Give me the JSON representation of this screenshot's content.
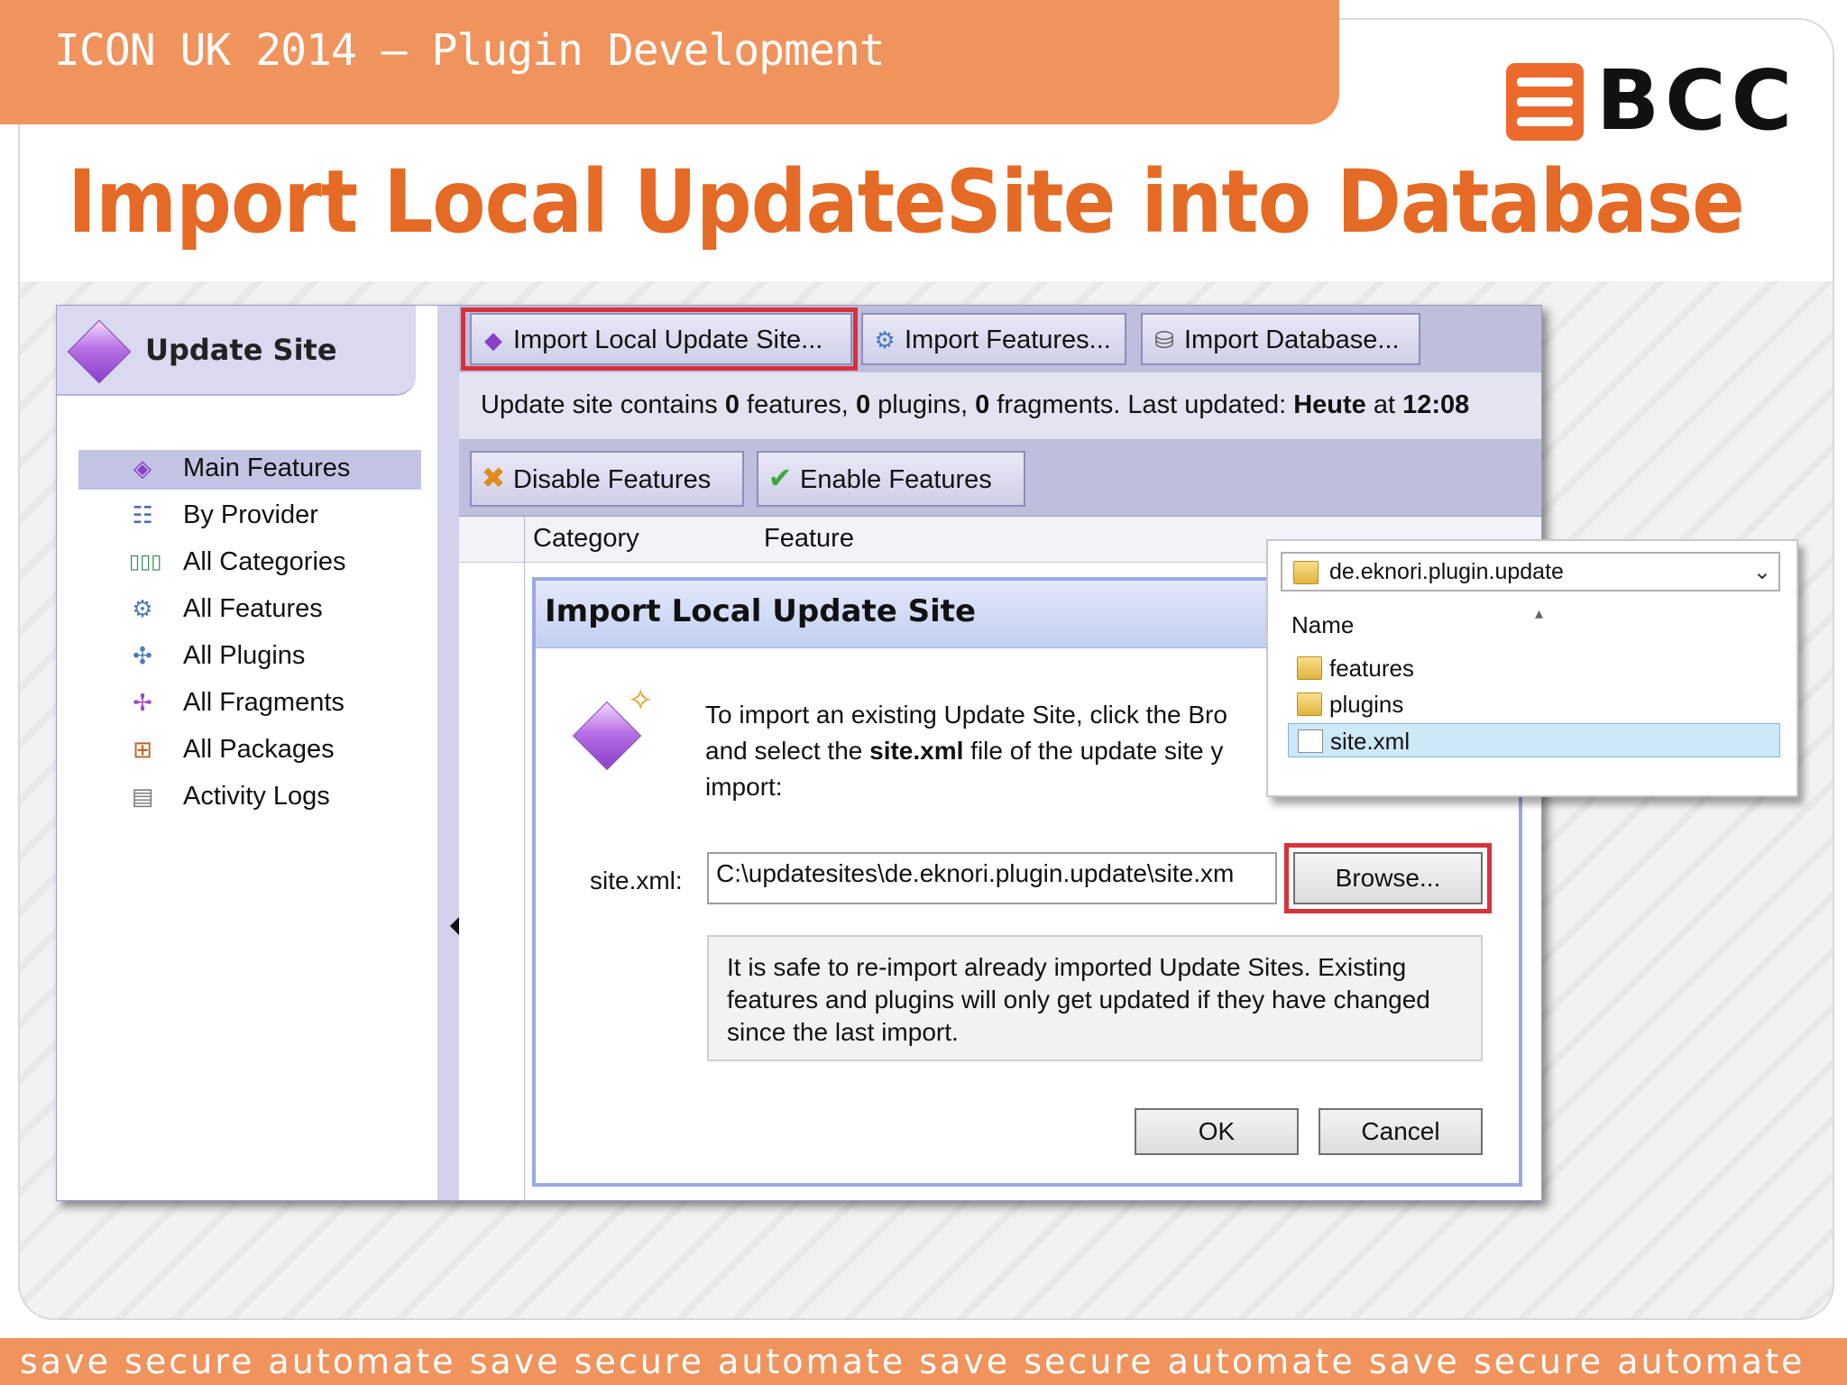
{
  "header": {
    "title": "ICON UK  2014 – Plugin Development",
    "logo_text": "BCC",
    "accent_color": "#f0935c",
    "logo_color": "#ec6a2c"
  },
  "slide_title": "Import Local UpdateSite into Database",
  "footer": {
    "text": "save secure automate save secure automate save secure automate save secure automate"
  },
  "left_panel": {
    "title": "Update Site",
    "items": [
      {
        "label": "Main Features",
        "icon": "main-features-icon",
        "selected": true
      },
      {
        "label": "By Provider",
        "icon": "provider-tree-icon"
      },
      {
        "label": "All Categories",
        "icon": "categories-icon"
      },
      {
        "label": "All Features",
        "icon": "features-icon"
      },
      {
        "label": "All Plugins",
        "icon": "plugins-icon"
      },
      {
        "label": "All Fragments",
        "icon": "fragments-icon"
      },
      {
        "label": "All Packages",
        "icon": "packages-icon"
      },
      {
        "label": "Activity Logs",
        "icon": "log-document-icon"
      }
    ]
  },
  "toolbar": {
    "import_local": "Import Local Update Site...",
    "import_features": "Import Features...",
    "import_database": "Import Database..."
  },
  "status": {
    "p1": "Update site contains ",
    "features_count": "0",
    "p2": " features, ",
    "plugins_count": "0",
    "p3": " plugins, ",
    "fragments_count": "0",
    "p4": " fragments. Last updated: ",
    "day": "Heute",
    "p5": " at ",
    "time": "12:08"
  },
  "actions": {
    "disable": "Disable Features",
    "enable": "Enable Features"
  },
  "table": {
    "columns": [
      "Category",
      "Feature"
    ]
  },
  "dialog": {
    "title": "Import Local Update Site",
    "desc_line1": "To import an existing Update Site, click the Bro",
    "desc_line2_pre": "and select the ",
    "desc_line2_bold": "site.xml",
    "desc_line2_post": " file of the update site y",
    "desc_line3": "import:",
    "field_label": "site.xml:",
    "field_value": "C:\\updatesites\\de.eknori.plugin.update\\site.xm",
    "browse": "Browse...",
    "info": "It is safe to re-import already imported Update Sites. Existing features and plugins will only get updated if they have changed since the last import.",
    "ok": "OK",
    "cancel": "Cancel"
  },
  "file_popup": {
    "path": "de.eknori.plugin.update",
    "column": "Name",
    "files": [
      {
        "name": "features",
        "type": "folder"
      },
      {
        "name": "plugins",
        "type": "folder"
      },
      {
        "name": "site.xml",
        "type": "file",
        "selected": true
      }
    ]
  }
}
